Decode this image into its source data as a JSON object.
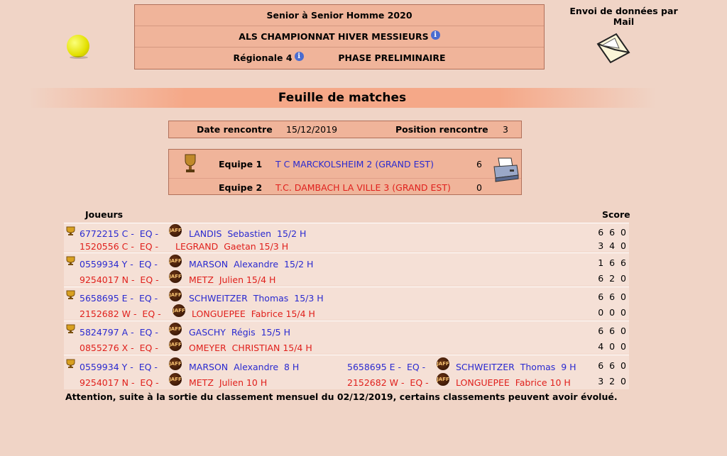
{
  "header": {
    "line1": "Senior  à Senior  Homme  2020",
    "line2": "ALS CHAMPIONNAT HIVER MESSIEURS",
    "division": "Régionale 4",
    "phase": "PHASE PRELIMINAIRE"
  },
  "mail_label": "Envoi de données par Mail",
  "title": "Feuille de matches",
  "meeting": {
    "date_label": "Date rencontre",
    "date": "15/12/2019",
    "position_label": "Position rencontre",
    "position": "3"
  },
  "teams": {
    "team1_label": "Equipe 1",
    "team1_name": "T C MARCKOLSHEIM 2 (GRAND EST)",
    "team1_score": "6",
    "team2_label": "Equipe 2",
    "team2_name": "T.C. DAMBACH LA VILLE 3 (GRAND EST)",
    "team2_score": "0"
  },
  "table": {
    "players_header": "Joueurs",
    "score_header": "Score"
  },
  "matches": [
    {
      "p1": "6772215 C -  EQ -",
      "n1": "LANDIS  Sebastien  15/2 H",
      "s1": "6 6 0",
      "p2": "1520556 C -  EQ -",
      "n2": "LEGRAND  Gaetan 15/3 H",
      "s2": "3 4 0"
    },
    {
      "p1": "0559934 Y -  EQ -",
      "n1": "MARSON  Alexandre  15/2 H",
      "s1": "1 6 6",
      "p2": "9254017 N -  EQ -",
      "n2": "METZ  Julien 15/4 H",
      "s2": "6 2 0"
    },
    {
      "p1": "5658695 E -  EQ -",
      "n1": "SCHWEITZER  Thomas  15/3 H",
      "s1": "6 6 0",
      "p2": "2152682 W -  EQ -",
      "n2": "LONGUEPEE  Fabrice 15/4 H",
      "s2": "0 0 0"
    },
    {
      "p1": "5824797 A -  EQ -",
      "n1": "GASCHY  Régis  15/5 H",
      "s1": "6 6 0",
      "p2": "0855276 X -  EQ -",
      "n2": "OMEYER  CHRISTIAN 15/4 H",
      "s2": "4 0 0"
    },
    {
      "p1": "0559934 Y -  EQ -",
      "n1": "MARSON  Alexandre  8 H",
      "q1": "5658695 E -  EQ -",
      "m1": "SCHWEITZER  Thomas  9 H",
      "s1": "6 6 0",
      "p2": "9254017 N -  EQ -",
      "n2": "METZ  Julien 10 H",
      "q2": "2152682 W -  EQ -",
      "m2": "LONGUEPEE  Fabrice 10 H",
      "s2": "3 2 0"
    }
  ],
  "attention": "Attention, suite à la sortie du classement mensuel du 02/12/2019, certains classements peuvent avoir évolué.",
  "icons": {
    "ball": "tennis-ball-icon",
    "mail": "envelope-icon",
    "trophy": "trophy-icon",
    "print": "printer-icon",
    "club_logo": "jaff-logo-icon",
    "info": "info-icon"
  },
  "colors": {
    "background": "#f0d4c6",
    "box": "#f0b49a",
    "winner": "#2a2ad0",
    "loser": "#e0201c"
  }
}
